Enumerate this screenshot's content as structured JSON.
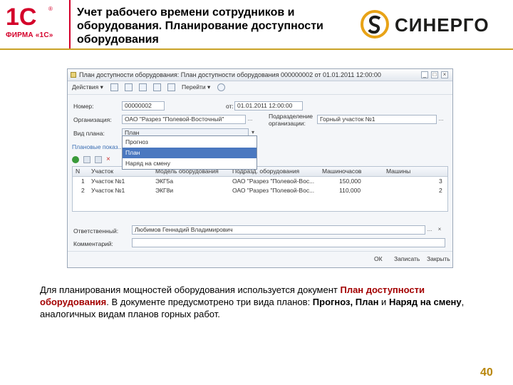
{
  "slide": {
    "logo_1c_mark": "1С",
    "logo_1c_firm": "ФИРМА «1С»",
    "title": "Учет рабочего времени сотрудников и оборудования. Планирование доступности оборудования",
    "synergo_logo": "СИНЕРГО",
    "page_number": "40",
    "accent_colors": {
      "red": "#d4002a",
      "gold": "#c9a227",
      "caption_highlight": "#a30000"
    }
  },
  "window": {
    "title": "План доступности оборудования: План доступности оборудования 000000002 от 01.01.2011 12:00:00",
    "toolbar": {
      "actions": "Действия",
      "goto": "Перейти"
    },
    "fields": {
      "number_label": "Номер:",
      "number_value": "00000002",
      "date_label": "от:",
      "date_value": "01.01.2011 12:00:00",
      "org_label": "Организация:",
      "org_value": "ОАО \"Разрез \"Полевой-Восточный\"",
      "subdiv_label": "Подразделение организации:",
      "subdiv_value": "Горный участок №1",
      "plan_type_label": "Вид плана:",
      "plan_type_value": "План"
    },
    "dropdown_options": [
      "Прогноз",
      "План",
      "Наряд на смену"
    ],
    "tab_label": "Плановые показ...",
    "grid": {
      "columns": [
        "N",
        "Участок",
        "Модель оборудования",
        "Подразд. оборудования",
        "Машиночасов",
        "Машины"
      ],
      "rows": [
        [
          "1",
          "Участок №1",
          "ЭКГ5а",
          "ОАО \"Разрез \"Полевой-Вос...",
          "150,000",
          "3"
        ],
        [
          "2",
          "Участок №1",
          "ЭКГ8и",
          "ОАО \"Разрез \"Полевой-Вос...",
          "110,000",
          "2"
        ]
      ]
    },
    "responsible_label": "Ответственный:",
    "responsible_value": "Любимов Геннадий Владимирович",
    "comment_label": "Комментарий:",
    "buttons": {
      "ok": "ОК",
      "save": "Записать",
      "close": "Закрыть"
    }
  },
  "caption": {
    "part1": "Для планирования мощностей оборудования используется документ ",
    "highlight": "План доступности оборудования",
    "part2": ". В документе предусмотрено три вида планов: ",
    "bold_types": "Прогноз, План",
    "part3": " и ",
    "bold_type3": "Наряд на смену",
    "part4": ", аналогичных видам планов горных работ."
  }
}
